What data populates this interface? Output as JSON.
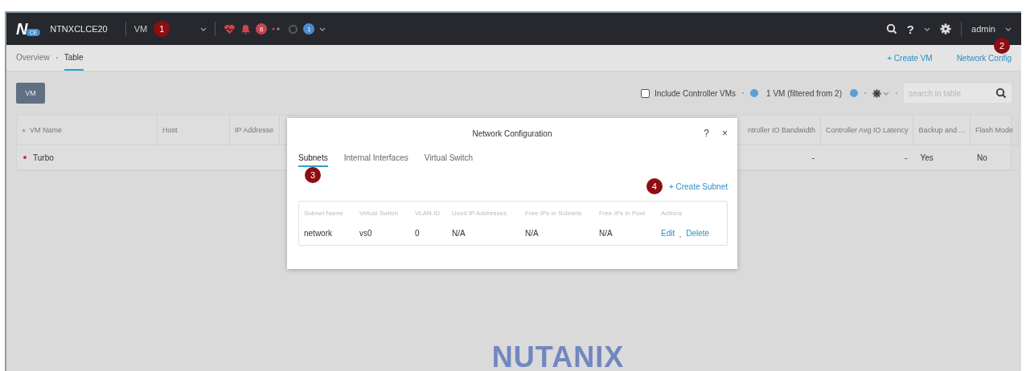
{
  "header": {
    "logo": {
      "mark": "N",
      "badge": "CE"
    },
    "cluster": "NTNXCLCE20",
    "section": {
      "label": "VM",
      "marker": "1"
    },
    "alerts_count": "6",
    "tasks_count": "1",
    "help": "?",
    "user": "admin"
  },
  "breadcrumb": [
    {
      "label": "Overview",
      "selected": false
    },
    {
      "label": "Table",
      "selected": true
    }
  ],
  "actions": [
    {
      "label": "+ Create VM"
    },
    {
      "label": "Network Config",
      "marker": "2"
    }
  ],
  "view_button": "VM",
  "toolbar": {
    "include_controller_vms": {
      "label": "Include Controller VMs",
      "checked": false
    },
    "count": "1 VM (filtered from 2)",
    "search": {
      "placeholder": "search in table"
    }
  },
  "table": {
    "columns": [
      {
        "label": "VM Name",
        "sorted": true
      },
      {
        "label": "Host",
        "sorted": false
      },
      {
        "label": "IP Addresse",
        "sorted": false
      },
      {
        "label": "ntroller IO Bandwidth",
        "sorted": false
      },
      {
        "label": "Controller Avg IO Latency",
        "sorted": false
      },
      {
        "label": "Backup and ...",
        "sorted": false
      },
      {
        "label": "Flash Mode",
        "sorted": false
      }
    ],
    "rows": [
      {
        "color": "#c8323c",
        "vm_name": "Turbo",
        "values": [
          "-",
          "-",
          "Yes",
          "No"
        ]
      }
    ]
  },
  "modal": {
    "title": "Network Configuration",
    "help": "?",
    "close": "×",
    "tabs": [
      {
        "label": "Subnets",
        "selected": true,
        "marker": "3"
      },
      {
        "label": "Internal Interfaces",
        "selected": false
      },
      {
        "label": "Virtual Switch",
        "selected": false
      }
    ],
    "create_action": {
      "label": "+ Create Subnet",
      "marker": "4"
    },
    "table": {
      "columns": [
        "Subnet Name",
        "Virtual Switch",
        "VLAN ID",
        "Used IP Addresses",
        "Free IPs in Subnets",
        "Free IPs in Pool",
        "Actions"
      ],
      "rows": [
        {
          "cells": [
            "network",
            "vs0",
            "0",
            "N/A",
            "N/A",
            "N/A"
          ],
          "actions": [
            "Edit",
            "Delete"
          ]
        }
      ]
    }
  },
  "footer_logo": "NUTANIX"
}
